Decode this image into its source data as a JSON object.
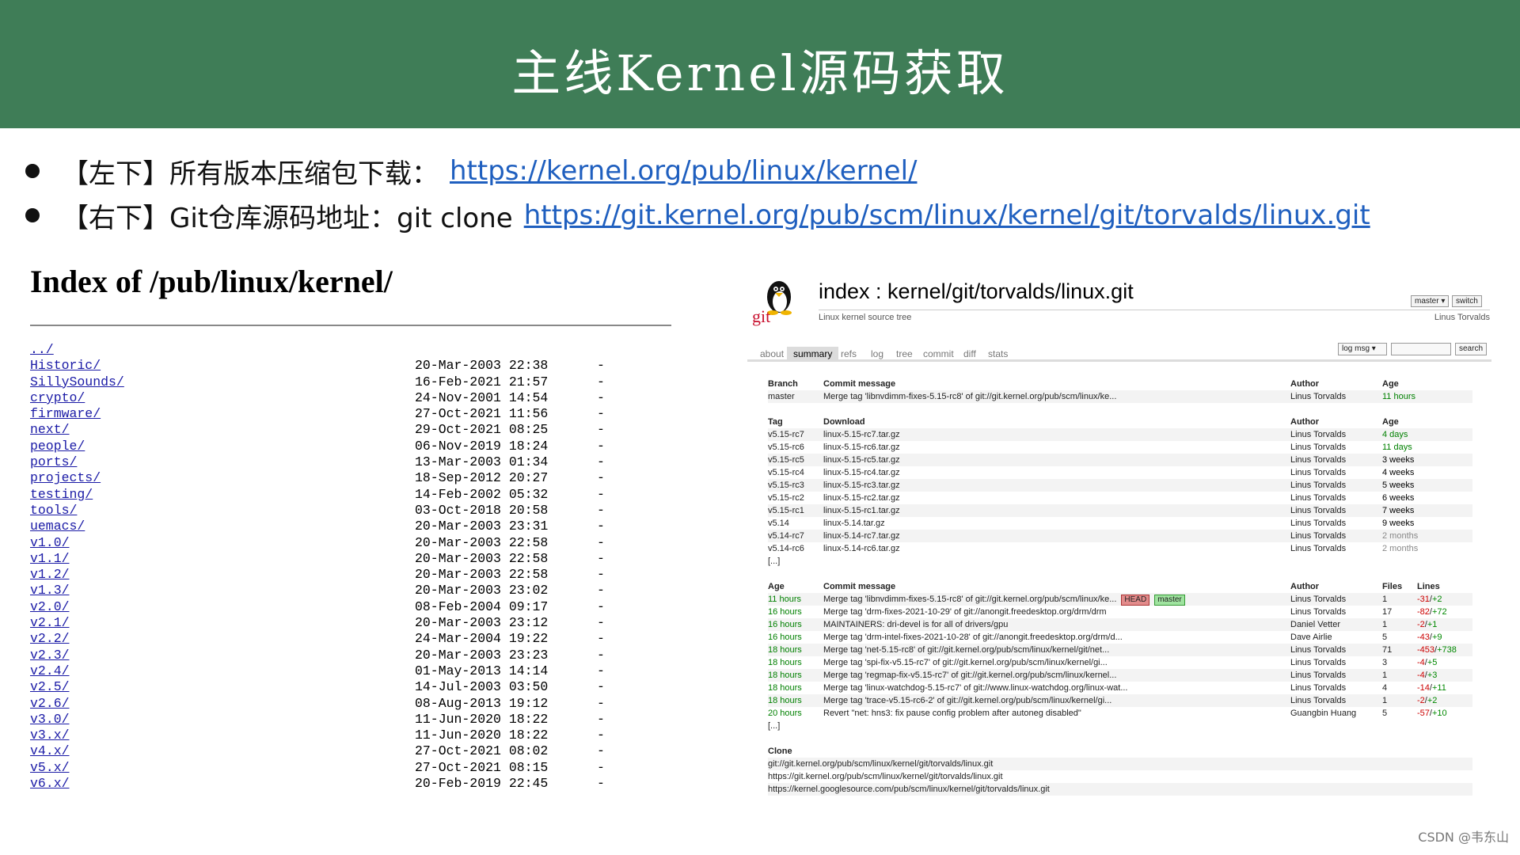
{
  "title": "主线Kernel源码获取",
  "bullets": [
    {
      "prefix": "【左下】所有版本压缩包下载：",
      "link": "https://kernel.org/pub/linux/kernel/"
    },
    {
      "prefix": "【右下】Git仓库源码地址：git clone",
      "link": "https://git.kernel.org/pub/scm/linux/kernel/git/torvalds/linux.git"
    }
  ],
  "index": {
    "heading": "Index of /pub/linux/kernel/",
    "entries": [
      {
        "name": "../",
        "date": "",
        "size": ""
      },
      {
        "name": "Historic/",
        "date": "20-Mar-2003 22:38",
        "size": "-"
      },
      {
        "name": "SillySounds/",
        "date": "16-Feb-2021 21:57",
        "size": "-"
      },
      {
        "name": "crypto/",
        "date": "24-Nov-2001 14:54",
        "size": "-"
      },
      {
        "name": "firmware/",
        "date": "27-Oct-2021 11:56",
        "size": "-"
      },
      {
        "name": "next/",
        "date": "29-Oct-2021 08:25",
        "size": "-"
      },
      {
        "name": "people/",
        "date": "06-Nov-2019 18:24",
        "size": "-"
      },
      {
        "name": "ports/",
        "date": "13-Mar-2003 01:34",
        "size": "-"
      },
      {
        "name": "projects/",
        "date": "18-Sep-2012 20:27",
        "size": "-"
      },
      {
        "name": "testing/",
        "date": "14-Feb-2002 05:32",
        "size": "-"
      },
      {
        "name": "tools/",
        "date": "03-Oct-2018 20:58",
        "size": "-"
      },
      {
        "name": "uemacs/",
        "date": "20-Mar-2003 23:31",
        "size": "-"
      },
      {
        "name": "v1.0/",
        "date": "20-Mar-2003 22:58",
        "size": "-"
      },
      {
        "name": "v1.1/",
        "date": "20-Mar-2003 22:58",
        "size": "-"
      },
      {
        "name": "v1.2/",
        "date": "20-Mar-2003 22:58",
        "size": "-"
      },
      {
        "name": "v1.3/",
        "date": "20-Mar-2003 23:02",
        "size": "-"
      },
      {
        "name": "v2.0/",
        "date": "08-Feb-2004 09:17",
        "size": "-"
      },
      {
        "name": "v2.1/",
        "date": "20-Mar-2003 23:12",
        "size": "-"
      },
      {
        "name": "v2.2/",
        "date": "24-Mar-2004 19:22",
        "size": "-"
      },
      {
        "name": "v2.3/",
        "date": "20-Mar-2003 23:23",
        "size": "-"
      },
      {
        "name": "v2.4/",
        "date": "01-May-2013 14:14",
        "size": "-"
      },
      {
        "name": "v2.5/",
        "date": "14-Jul-2003 03:50",
        "size": "-"
      },
      {
        "name": "v2.6/",
        "date": "08-Aug-2013 19:12",
        "size": "-"
      },
      {
        "name": "v3.0/",
        "date": "11-Jun-2020 18:22",
        "size": "-"
      },
      {
        "name": "v3.x/",
        "date": "11-Jun-2020 18:22",
        "size": "-"
      },
      {
        "name": "v4.x/",
        "date": "27-Oct-2021 08:02",
        "size": "-"
      },
      {
        "name": "v5.x/",
        "date": "27-Oct-2021 08:15",
        "size": "-"
      },
      {
        "name": "v6.x/",
        "date": "20-Feb-2019 22:45",
        "size": "-"
      }
    ]
  },
  "cgit": {
    "logo_text": "git",
    "title": "index : kernel/git/torvalds/linux.git",
    "description": "Linux kernel source tree",
    "owner": "Linus Torvalds",
    "branch_select": "master",
    "switch_label": "switch",
    "tabs": [
      "about",
      "summary",
      "refs",
      "log",
      "tree",
      "commit",
      "diff",
      "stats"
    ],
    "active_tab": "summary",
    "search_select": "log msg",
    "search_label": "search",
    "branch_table": {
      "headers": [
        "Branch",
        "Commit message",
        "Author",
        "Age"
      ],
      "rows": [
        [
          "master",
          "Merge tag 'libnvdimm-fixes-5.15-rc8' of git://git.kernel.org/pub/scm/linux/ke...",
          "Linus Torvalds",
          "11 hours"
        ]
      ]
    },
    "tag_table": {
      "headers": [
        "Tag",
        "Download",
        "Author",
        "Age"
      ],
      "rows": [
        [
          "v5.15-rc7",
          "linux-5.15-rc7.tar.gz",
          "Linus Torvalds",
          "4 days"
        ],
        [
          "v5.15-rc6",
          "linux-5.15-rc6.tar.gz",
          "Linus Torvalds",
          "11 days"
        ],
        [
          "v5.15-rc5",
          "linux-5.15-rc5.tar.gz",
          "Linus Torvalds",
          "3 weeks"
        ],
        [
          "v5.15-rc4",
          "linux-5.15-rc4.tar.gz",
          "Linus Torvalds",
          "4 weeks"
        ],
        [
          "v5.15-rc3",
          "linux-5.15-rc3.tar.gz",
          "Linus Torvalds",
          "5 weeks"
        ],
        [
          "v5.15-rc2",
          "linux-5.15-rc2.tar.gz",
          "Linus Torvalds",
          "6 weeks"
        ],
        [
          "v5.15-rc1",
          "linux-5.15-rc1.tar.gz",
          "Linus Torvalds",
          "7 weeks"
        ],
        [
          "v5.14",
          "linux-5.14.tar.gz",
          "Linus Torvalds",
          "9 weeks"
        ],
        [
          "v5.14-rc7",
          "linux-5.14-rc7.tar.gz",
          "Linus Torvalds",
          "2 months"
        ],
        [
          "v5.14-rc6",
          "linux-5.14-rc6.tar.gz",
          "Linus Torvalds",
          "2 months"
        ]
      ],
      "more": "[...]"
    },
    "log_table": {
      "headers": [
        "Age",
        "Commit message",
        "Author",
        "Files",
        "Lines"
      ],
      "rows": [
        {
          "age": "11 hours",
          "msg": "Merge tag 'libnvdimm-fixes-5.15-rc8' of git://git.kernel.org/pub/scm/linux/ke...",
          "author": "Linus Torvalds",
          "files": "1",
          "del": "-31",
          "add": "+2",
          "head": "HEAD",
          "branch": "master"
        },
        {
          "age": "16 hours",
          "msg": "Merge tag 'drm-fixes-2021-10-29' of git://anongit.freedesktop.org/drm/drm",
          "author": "Linus Torvalds",
          "files": "17",
          "del": "-82",
          "add": "+72"
        },
        {
          "age": "16 hours",
          "msg": "MAINTAINERS: dri-devel is for all of drivers/gpu",
          "author": "Daniel Vetter",
          "files": "1",
          "del": "-2",
          "add": "+1"
        },
        {
          "age": "16 hours",
          "msg": "Merge tag 'drm-intel-fixes-2021-10-28' of git://anongit.freedesktop.org/drm/d...",
          "author": "Dave Airlie",
          "files": "5",
          "del": "-43",
          "add": "+9"
        },
        {
          "age": "18 hours",
          "msg": "Merge tag 'net-5.15-rc8' of git://git.kernel.org/pub/scm/linux/kernel/git/net...",
          "author": "Linus Torvalds",
          "files": "71",
          "del": "-453",
          "add": "+738"
        },
        {
          "age": "18 hours",
          "msg": "Merge tag 'spi-fix-v5.15-rc7' of git://git.kernel.org/pub/scm/linux/kernel/gi...",
          "author": "Linus Torvalds",
          "files": "3",
          "del": "-4",
          "add": "+5"
        },
        {
          "age": "18 hours",
          "msg": "Merge tag 'regmap-fix-v5.15-rc7' of git://git.kernel.org/pub/scm/linux/kernel...",
          "author": "Linus Torvalds",
          "files": "1",
          "del": "-4",
          "add": "+3"
        },
        {
          "age": "18 hours",
          "msg": "Merge tag 'linux-watchdog-5.15-rc7' of git://www.linux-watchdog.org/linux-wat...",
          "author": "Linus Torvalds",
          "files": "4",
          "del": "-14",
          "add": "+11"
        },
        {
          "age": "18 hours",
          "msg": "Merge tag 'trace-v5.15-rc6-2' of git://git.kernel.org/pub/scm/linux/kernel/gi...",
          "author": "Linus Torvalds",
          "files": "1",
          "del": "-2",
          "add": "+2"
        },
        {
          "age": "20 hours",
          "msg": "Revert \"net: hns3: fix pause config problem after autoneg disabled\"",
          "author": "Guangbin Huang",
          "files": "5",
          "del": "-57",
          "add": "+10"
        }
      ],
      "more": "[...]"
    },
    "clone": {
      "header": "Clone",
      "urls": [
        "git://git.kernel.org/pub/scm/linux/kernel/git/torvalds/linux.git",
        "https://git.kernel.org/pub/scm/linux/kernel/git/torvalds/linux.git",
        "https://kernel.googlesource.com/pub/scm/linux/kernel/git/torvalds/linux.git"
      ]
    }
  },
  "watermark": "CSDN @韦东山",
  "colors": {
    "header_bg": "#3f7d57",
    "link": "#1f5fbf",
    "age_recent": "#008000"
  }
}
